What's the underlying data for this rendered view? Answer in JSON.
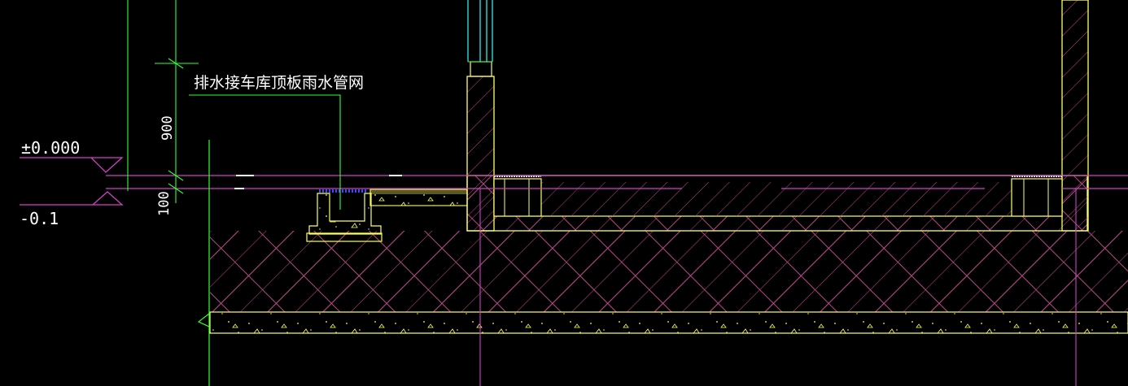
{
  "annotations": {
    "note_label": "排水接车库顶板雨水管网",
    "elevation_top": "±0.000",
    "elevation_bottom": "-0.1",
    "dimension_900": "900",
    "dimension_100": "100"
  },
  "colors": {
    "background": "#000000",
    "wall_outline": "#ffff66",
    "hatch": "#b84a86",
    "magenta_line": "#d040c8",
    "green_line": "#33ff33",
    "cyan_line": "#33ffff",
    "grate": "#4444ff",
    "text": "#ffffff"
  }
}
